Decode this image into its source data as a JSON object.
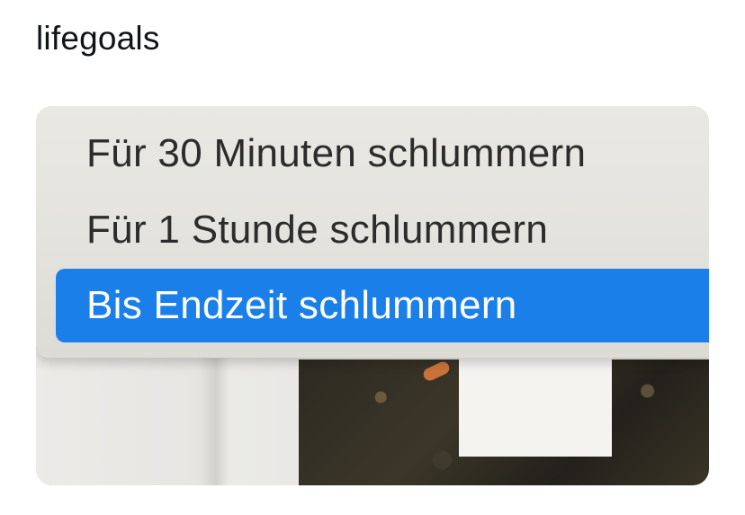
{
  "post": {
    "text": "lifegoals"
  },
  "menu": {
    "items": [
      {
        "label": "Für 30 Minuten schlummern",
        "selected": false
      },
      {
        "label": "Für 1 Stunde schlummern",
        "selected": false
      },
      {
        "label": "Bis Endzeit schlummern",
        "selected": true
      }
    ],
    "highlight_color": "#1a7fe9"
  }
}
